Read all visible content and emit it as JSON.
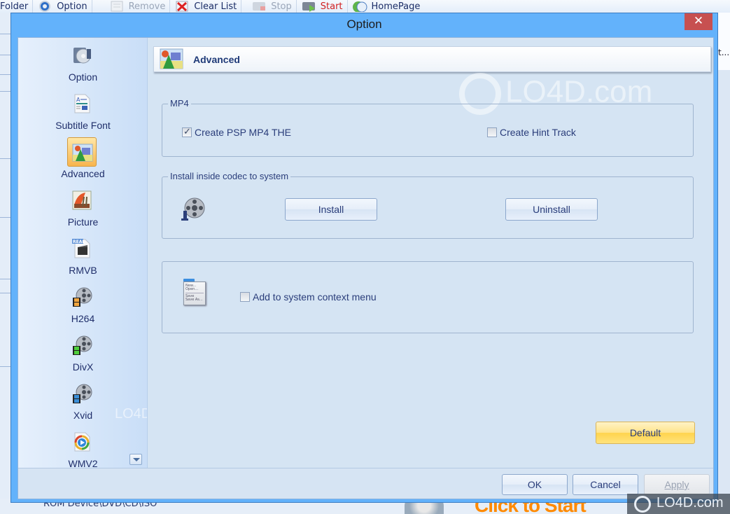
{
  "background_app": {
    "toolbar": [
      {
        "label": "Folder",
        "icon": "folder-icon",
        "state": "normal"
      },
      {
        "label": "Option",
        "icon": "gear-icon",
        "state": "normal"
      },
      {
        "label": "Remove",
        "icon": "document-icon",
        "state": "disabled"
      },
      {
        "label": "Clear List",
        "icon": "clear-list-icon",
        "state": "normal"
      },
      {
        "label": "Stop",
        "icon": "stop-icon",
        "state": "disabled"
      },
      {
        "label": "Start",
        "icon": "start-icon",
        "state": "accent"
      },
      {
        "label": "HomePage",
        "icon": "globe-icon",
        "state": "normal"
      }
    ],
    "status_path": "ROM Device\\DVD\\CD\\ISO",
    "truncated_text": "t...",
    "banner_text": "Click to Start"
  },
  "dialog": {
    "title": "Option",
    "close_label": "✕",
    "sidebar": {
      "items": [
        {
          "label": "Option",
          "icon": "option-icon",
          "active": false
        },
        {
          "label": "Subtitle Font",
          "icon": "subtitle-font-icon",
          "active": false
        },
        {
          "label": "Advanced",
          "icon": "advanced-icon",
          "active": true
        },
        {
          "label": "Picture",
          "icon": "picture-icon",
          "active": false
        },
        {
          "label": "RMVB",
          "icon": "rmvb-icon",
          "active": false
        },
        {
          "label": "H264",
          "icon": "h264-film-icon",
          "active": false
        },
        {
          "label": "DivX",
          "icon": "divx-film-icon",
          "active": false
        },
        {
          "label": "Xvid",
          "icon": "xvid-film-icon",
          "active": false
        },
        {
          "label": "WMV2",
          "icon": "wmv2-icon",
          "active": false
        }
      ]
    },
    "panel": {
      "header_title": "Advanced",
      "mp4_group": {
        "legend": "MP4",
        "create_psp_label": "Create PSP MP4 THE",
        "create_psp_checked": true,
        "create_hint_label": "Create Hint Track",
        "create_hint_checked": false
      },
      "codec_group": {
        "legend": "Install inside codec to system",
        "install_label": "Install",
        "uninstall_label": "Uninstall"
      },
      "context_group": {
        "context_menu_label": "Add to system context menu",
        "context_menu_checked": false,
        "menu_preview_lines": [
          "New...",
          "Open...",
          "Save",
          "Save As..."
        ]
      },
      "default_label": "Default"
    },
    "footer": {
      "ok_label": "OK",
      "cancel_label": "Cancel",
      "apply_label": "Apply"
    }
  },
  "watermark": {
    "text": "LO4D.com"
  },
  "colors": {
    "titlebar": "#63b2fb",
    "close": "#c75050",
    "client_bg": "#d5e4f3",
    "text_blue": "#2a3d7a",
    "default_button": "#ffd44d",
    "start_accent": "#d11f1f"
  }
}
